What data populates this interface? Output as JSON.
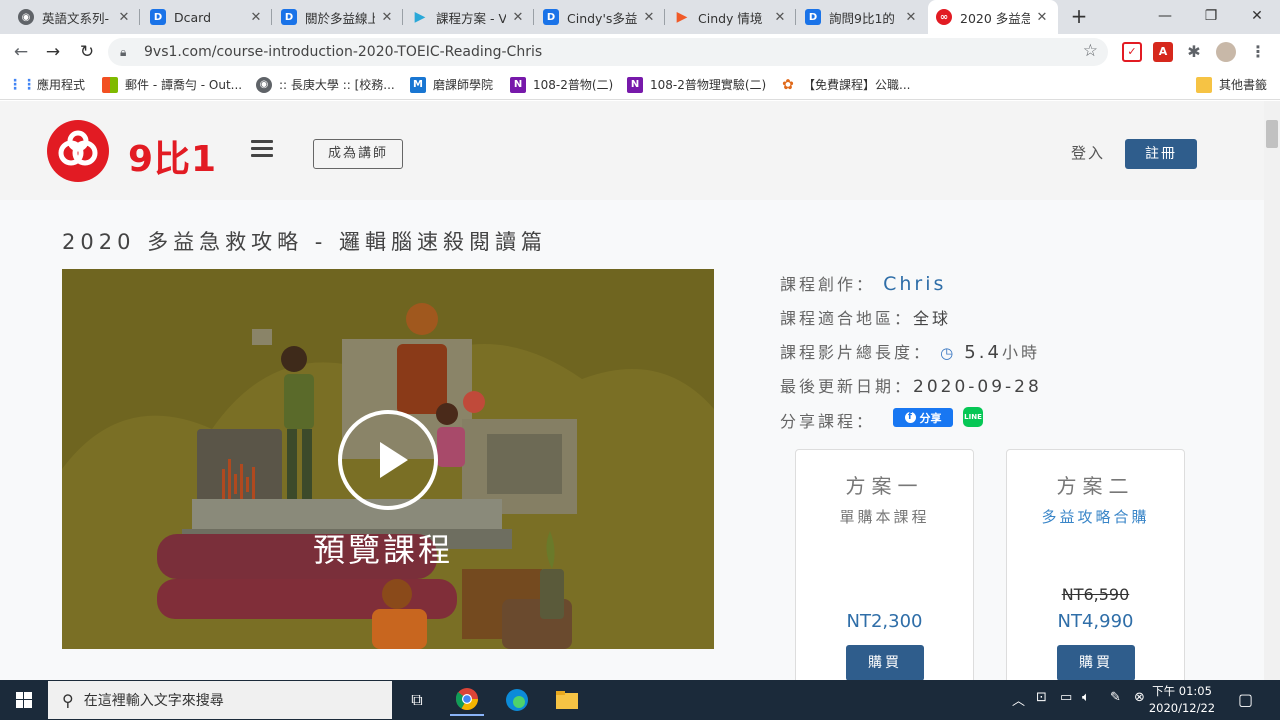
{
  "browser": {
    "tabs": [
      {
        "title": "英語文系列-",
        "favicon": "globe-icon",
        "active": false
      },
      {
        "title": "Dcard",
        "favicon": "dcard-icon",
        "active": false
      },
      {
        "title": "關於多益線上",
        "favicon": "dcard-icon",
        "active": false
      },
      {
        "title": "課程方案 - V",
        "favicon": "play-icon",
        "active": false
      },
      {
        "title": "Cindy's多益",
        "favicon": "dcard-icon",
        "active": false
      },
      {
        "title": "Cindy 情境",
        "favicon": "play-icon",
        "active": false
      },
      {
        "title": "詢問9比1的",
        "favicon": "dcard-icon",
        "active": false
      },
      {
        "title": "2020 多益急",
        "favicon": "9vs1-icon",
        "active": true
      }
    ],
    "url": "9vs1.com/course-introduction-2020-TOEIC-Reading-Chris",
    "bookmarks": [
      {
        "label": "應用程式",
        "icon": "apps-icon"
      },
      {
        "label": "郵件 - 譚喬勻 - Out...",
        "icon": "microsoft-icon"
      },
      {
        "label": ":: 長庚大學 :: [校務...",
        "icon": "globe-icon"
      },
      {
        "label": "磨課師學院",
        "icon": "m-icon"
      },
      {
        "label": "108-2普物(二)",
        "icon": "onenote-icon"
      },
      {
        "label": "108-2普物理實驗(二)",
        "icon": "onenote-icon"
      },
      {
        "label": "【免費課程】公職...",
        "icon": "leaf-icon"
      }
    ],
    "other_bookmarks": "其他書籤"
  },
  "site": {
    "logo_text": "9比1",
    "become_teacher": "成為講師",
    "login": "登入",
    "register": "註冊"
  },
  "course": {
    "title": "2020 多益急救攻略 - 邏輯腦速殺閱讀篇",
    "preview_label": "預覽課程",
    "creator_label": "課程創作：",
    "creator_name": "Chris",
    "region_label": "課程適合地區：",
    "region_value": "全球",
    "duration_label": "課程影片總長度：",
    "duration_value": "5.4",
    "duration_unit": "小時",
    "updated_label": "最後更新日期：",
    "updated_value": "2020-09-28",
    "share_label": "分享課程：",
    "fb_share": "分享",
    "line_share": "LINE"
  },
  "plans": [
    {
      "title": "方案一",
      "subtitle": "單購本課程",
      "original_price": "",
      "price": "NT2,300",
      "buy": "購買"
    },
    {
      "title": "方案二",
      "subtitle": "多益攻略合購",
      "original_price": "NT6,590",
      "price": "NT4,990",
      "buy": "購買"
    }
  ],
  "taskbar": {
    "search_placeholder": "在這裡輸入文字來搜尋",
    "time": "下午 01:05",
    "date": "2020/12/22"
  },
  "colors": {
    "brand_red": "#e21b23",
    "brand_blue": "#2f5d8c",
    "link_blue": "#2f6ea8"
  }
}
